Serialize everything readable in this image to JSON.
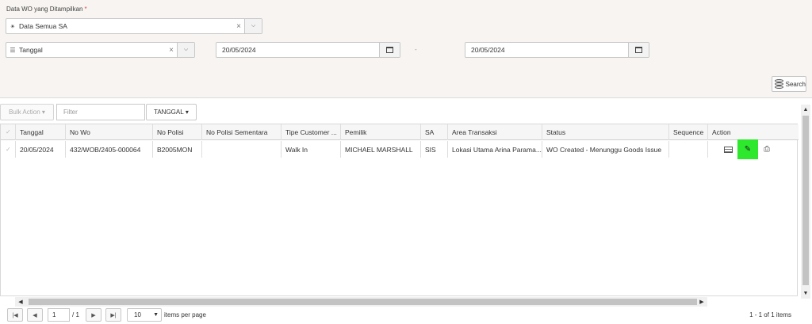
{
  "filters": {
    "label": "Data WO yang Ditampilkan",
    "required_mark": "*",
    "data_select": {
      "value": "Data Semua SA",
      "icon": "user-icon"
    },
    "date_type_select": {
      "value": "Tanggal",
      "icon": "list-icon"
    },
    "date_from": "20/05/2024",
    "date_to": "20/05/2024",
    "separator": "-",
    "clear_symbol": "×",
    "search_label": "Search"
  },
  "toolbar": {
    "bulk_action": "Bulk Action",
    "filter_placeholder": "Filter",
    "date_field_button": "TANGGAL"
  },
  "grid": {
    "columns": [
      "Tanggal",
      "No Wo",
      "No Polisi",
      "No Polisi Sementara",
      "Tipe Customer ...",
      "Pemilik",
      "SA",
      "Area Transaksi",
      "Status",
      "Sequence",
      "Action"
    ],
    "rows": [
      {
        "tanggal": "20/05/2024",
        "no_wo": "432/WOB/2405-000064",
        "no_polisi": "B2005MON",
        "no_polisi_sementara": "",
        "tipe_customer": "Walk In",
        "pemilik": "MICHAEL MARSHALL",
        "sa": "SIS",
        "area_transaksi": "Lokasi Utama Arina Parama...",
        "status": "WO Created - Menunggu Goods Issue",
        "sequence": ""
      }
    ]
  },
  "pager": {
    "current_page": "1",
    "total_pages_label": "/ 1",
    "page_size": "10",
    "page_size_label": "items per page",
    "info": "1 - 1 of 1 items"
  },
  "colors": {
    "panel_bg": "#f7f4f1",
    "edit_button": "#2ee82e"
  }
}
